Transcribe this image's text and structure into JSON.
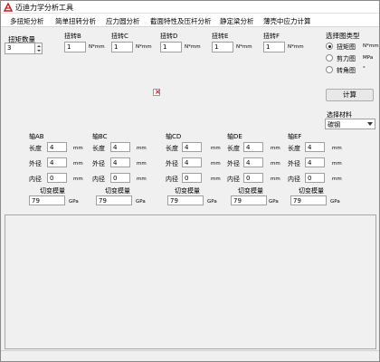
{
  "window": {
    "title": "迈迪力学分析工具"
  },
  "menu": [
    "多扭矩分析",
    "简单扭转分析",
    "应力圆分析",
    "截面特性及压杆分析",
    "静定梁分析",
    "薄壳中应力计算"
  ],
  "torque_count": {
    "label": "扭矩数量",
    "value": "3"
  },
  "torques": [
    {
      "label": "扭转B",
      "value": "1",
      "unit": "N*mm"
    },
    {
      "label": "扭转C",
      "value": "1",
      "unit": "N*mm"
    },
    {
      "label": "扭转D",
      "value": "1",
      "unit": "N*mm"
    },
    {
      "label": "扭转E",
      "value": "1",
      "unit": "N*mm"
    },
    {
      "label": "扭转F",
      "value": "1",
      "unit": "N*mm"
    }
  ],
  "chart_type": {
    "label": "选择图类型",
    "options": [
      {
        "label": "扭矩图",
        "unit": "N*mm",
        "selected": true
      },
      {
        "label": "剪力图",
        "unit": "MPa",
        "selected": false
      },
      {
        "label": "转角图",
        "unit": "°",
        "selected": false
      }
    ]
  },
  "calc_button": "计算",
  "material": {
    "label": "选择材料",
    "value": "碳钢"
  },
  "shafts": [
    {
      "title": "轴AB",
      "length_label": "长度",
      "length": "4",
      "outer_label": "外径",
      "outer": "4",
      "inner_label": "内径",
      "inner": "0",
      "unit": "mm",
      "modulus_label": "切变模量",
      "modulus": "79",
      "modulus_unit": "GPa"
    },
    {
      "title": "轴BC",
      "length_label": "长度",
      "length": "4",
      "outer_label": "外径",
      "outer": "4",
      "inner_label": "内径",
      "inner": "0",
      "unit": "mm",
      "modulus_label": "切变模量",
      "modulus": "79",
      "modulus_unit": "GPa"
    },
    {
      "title": "轴CD",
      "length_label": "长度",
      "length": "4",
      "outer_label": "外径",
      "outer": "4",
      "inner_label": "内径",
      "inner": "0",
      "unit": "mm",
      "modulus_label": "切变模量",
      "modulus": "79",
      "modulus_unit": "GPa"
    },
    {
      "title": "轴DE",
      "length_label": "长度",
      "length": "4",
      "outer_label": "外径",
      "outer": "4",
      "inner_label": "内径",
      "inner": "0",
      "unit": "mm",
      "modulus_label": "切变模量",
      "modulus": "79",
      "modulus_unit": "GPa"
    },
    {
      "title": "轴EF",
      "length_label": "长度",
      "length": "4",
      "outer_label": "外径",
      "outer": "4",
      "inner_label": "内径",
      "inner": "0",
      "unit": "mm",
      "modulus_label": "切变模量",
      "modulus": "79",
      "modulus_unit": "GPa"
    }
  ]
}
